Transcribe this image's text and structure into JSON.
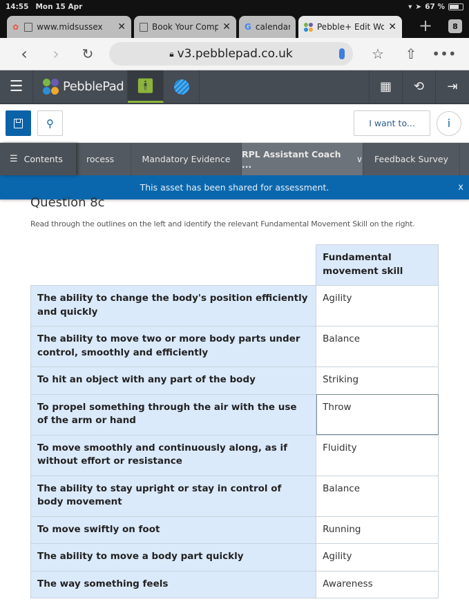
{
  "status_bar": {
    "time": "14:55",
    "date": "Mon 15 Apr",
    "battery": "67 %"
  },
  "browser_tabs": [
    {
      "title": "www.midsussex",
      "favicon": "page-icon",
      "active": false
    },
    {
      "title": "Book Your Compl",
      "favicon": "page-icon",
      "active": false
    },
    {
      "title": "calendar",
      "favicon": "google-icon",
      "active": false
    },
    {
      "title": "Pebble+ Edit Wor",
      "favicon": "pebblepad-icon",
      "active": true
    }
  ],
  "tab_count": "8",
  "address_bar": {
    "url": "v3.pebblepad.co.uk"
  },
  "app_nav": {
    "brand": "PebblePad"
  },
  "toolbar": {
    "i_want_to": "I want to...",
    "info": "i"
  },
  "section_tabs": {
    "contents": "Contents",
    "items": [
      {
        "label": "rocess"
      },
      {
        "label": "Mandatory Evidence"
      },
      {
        "label": "RPL Assistant Coach ...",
        "active": true
      },
      {
        "label": "Feedback Survey"
      }
    ]
  },
  "banner": {
    "message": "This asset has been shared for assessment.",
    "close": "x"
  },
  "question": {
    "title": "Question 8c",
    "instruction": "Read through the outlines on the left and identify the relevant Fundamental Movement Skill on the right.",
    "column_header": "Fundamental movement skill",
    "rows": [
      {
        "description": "The ability to change the body's position efficiently and quickly",
        "answer": "Agility"
      },
      {
        "description": "The ability to move two or more body parts under control, smoothly and efficiently",
        "answer": "Balance"
      },
      {
        "description": "To hit an object with any part of the body",
        "answer": "Striking"
      },
      {
        "description": "To propel something through the air with the use of the arm or hand",
        "answer": "Throw"
      },
      {
        "description": "To move smoothly and continuously along, as if without effort or resistance",
        "answer": "Fluidity"
      },
      {
        "description": "The ability to stay upright or stay in control of body movement",
        "answer": "Balance"
      },
      {
        "description": "To move swiftly on foot",
        "answer": "Running"
      },
      {
        "description": "The ability to move a body part quickly",
        "answer": "Agility"
      },
      {
        "description": "The way something feels",
        "answer": "Awareness"
      }
    ]
  },
  "colors": {
    "brand_blue": "#0a67ad",
    "nav_dark": "#464c54",
    "accent_green": "#8cb43c",
    "cell_blue": "#dbeafa"
  }
}
